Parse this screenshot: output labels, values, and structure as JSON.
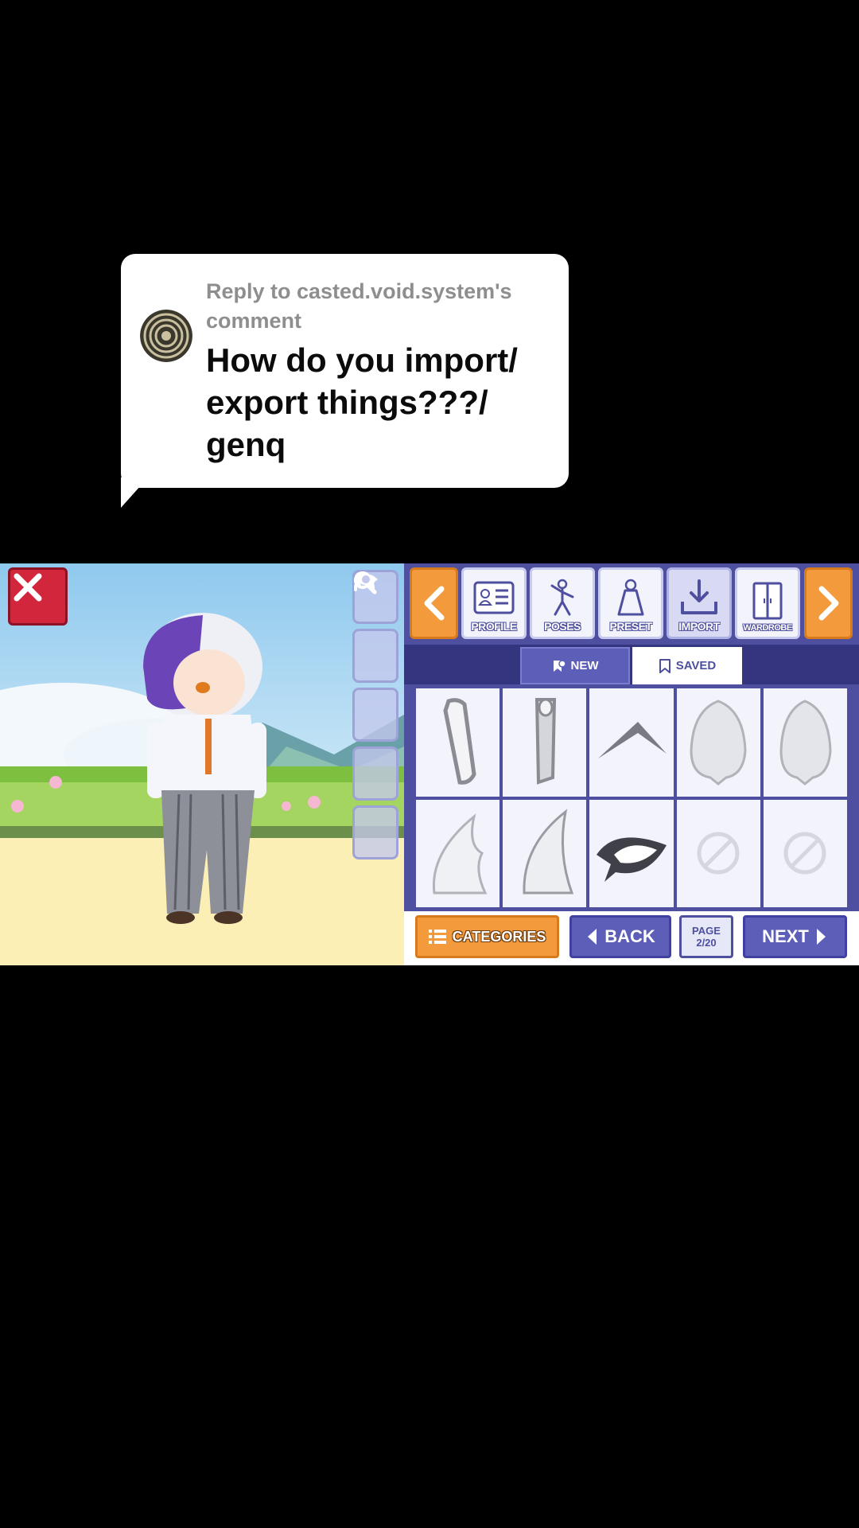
{
  "comment": {
    "reply_to": "Reply to casted.void.system's comment",
    "text": "How do you import/ export things???/ genq"
  },
  "toolbar": {
    "close_icon": "close-icon",
    "tools": [
      "undo-icon",
      "redo-icon",
      "zoom-in-icon",
      "zoom-out-icon",
      "eye-icon"
    ]
  },
  "menu": {
    "items": [
      {
        "label": "PROFILE",
        "icon": "profile-card-icon"
      },
      {
        "label": "POSES",
        "icon": "pose-figure-icon"
      },
      {
        "label": "PRESET",
        "icon": "preset-figure-icon"
      },
      {
        "label": "IMPORT",
        "icon": "import-icon",
        "active": true
      },
      {
        "label": "WARDROBE",
        "icon": "wardrobe-icon"
      }
    ]
  },
  "tabs": {
    "new_label": "NEW",
    "saved_label": "SAVED",
    "selected": "SAVED"
  },
  "footer": {
    "categories_label": "CATEGORIES",
    "back_label": "BACK",
    "page_label": "PAGE",
    "page_value": "2/20",
    "next_label": "NEXT"
  },
  "colors": {
    "accent_orange": "#f39a3c",
    "panel_purple": "#4e4f9f",
    "close_red": "#d1263b"
  }
}
